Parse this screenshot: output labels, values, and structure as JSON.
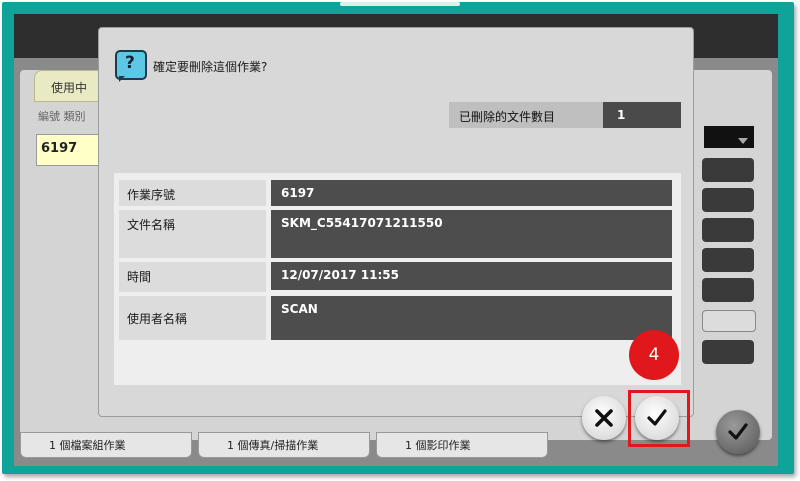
{
  "background_screen": {
    "tab_label": "使用中",
    "column_headers": "編號  類別",
    "job_row_number": "6197",
    "bottom_buttons": [
      "1  個檔案組作業",
      "1  個傳真/掃描作業",
      "1  個影印作業"
    ]
  },
  "dialog": {
    "title": "確定要刪除這個作業?",
    "title_icon": "question-icon",
    "deleted_count_label": "已刪除的文件數目",
    "deleted_count_value": "1",
    "rows": [
      {
        "label": "作業序號",
        "value": "6197"
      },
      {
        "label": "文件名稱",
        "value": "SKM_C55417071211550"
      },
      {
        "label": "時間",
        "value": "12/07/2017 11:55"
      },
      {
        "label": "使用者名稱",
        "value": "SCAN"
      }
    ]
  },
  "buttons": {
    "cancel_icon": "close-icon",
    "confirm_icon": "checkmark-icon"
  },
  "annotation": {
    "step_number": "4",
    "color": "#e0171b"
  },
  "colors": {
    "frame": "#0fa39a",
    "dialog_bg": "#d8d8d8",
    "value_bg": "#4d4d4d"
  }
}
